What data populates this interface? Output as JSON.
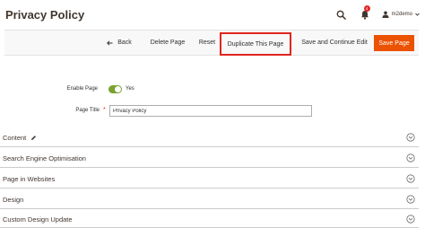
{
  "page": {
    "title": "Privacy Policy"
  },
  "header": {
    "notification_count": "4",
    "username": "m2demo"
  },
  "actions": {
    "back": "Back",
    "delete": "Delete Page",
    "reset": "Reset",
    "duplicate": "Duplicate This Page",
    "save_continue": "Save and Continue Edit",
    "save": "Save Page"
  },
  "form": {
    "enable_label": "Enable Page",
    "enable_value": "Yes",
    "title_label": "Page Title",
    "title_value": "Privacy Policy"
  },
  "sections": [
    {
      "label": "Content"
    },
    {
      "label": "Search Engine Optimisation"
    },
    {
      "label": "Page in Websites"
    },
    {
      "label": "Design"
    },
    {
      "label": "Custom Design Update"
    }
  ],
  "colors": {
    "accent": "#eb5202",
    "highlight_border": "#e0251f",
    "toggle_on": "#79a22e",
    "badge": "#e22626"
  },
  "icons": [
    "search-icon",
    "bell-icon",
    "user-icon",
    "arrow-left-icon",
    "pencil-icon",
    "chevron-down-icon"
  ]
}
